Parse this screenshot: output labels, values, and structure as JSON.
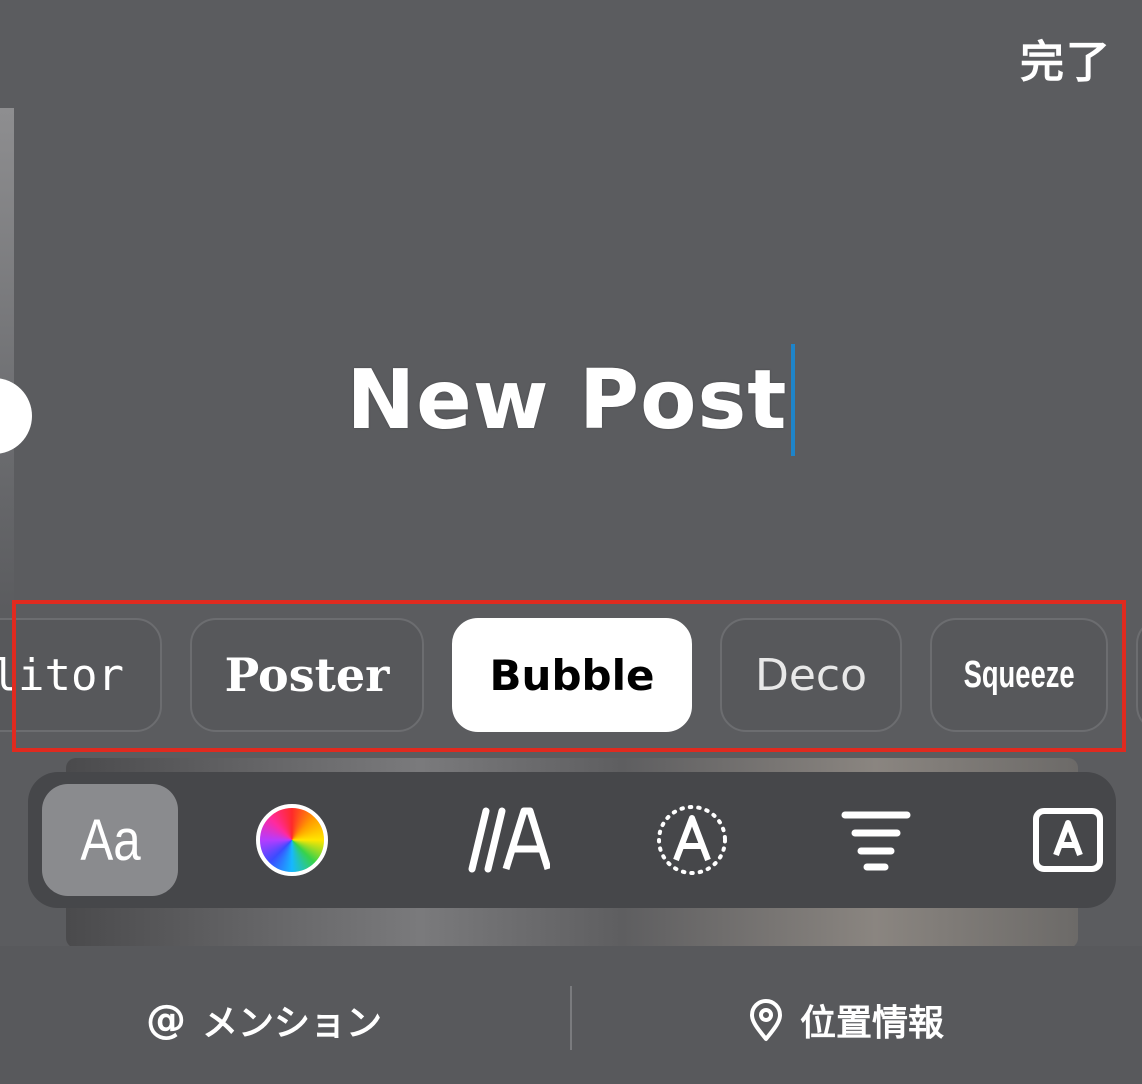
{
  "header": {
    "done_label": "完了"
  },
  "canvas": {
    "text": "New Post",
    "caret_color": "#1e84c9"
  },
  "font_selector": {
    "selected": "Bubble",
    "fonts": [
      {
        "label": "litor"
      },
      {
        "label": "Poster"
      },
      {
        "label": "Bubble"
      },
      {
        "label": "Deco"
      },
      {
        "label": "Squeeze"
      },
      {
        "label": ""
      }
    ],
    "highlight_color": "#e02a1f"
  },
  "toolbar": {
    "font_label": "Aa",
    "tools": [
      {
        "icon": "font-icon"
      },
      {
        "icon": "color-wheel-icon"
      },
      {
        "icon": "text-effects-icon"
      },
      {
        "icon": "text-animation-icon"
      },
      {
        "icon": "align-center-icon"
      },
      {
        "icon": "text-background-icon"
      }
    ]
  },
  "bottom_bar": {
    "mention": {
      "icon": "at-icon",
      "at": "@",
      "label": "メンション"
    },
    "location": {
      "icon": "location-pin-icon",
      "label": "位置情報"
    }
  }
}
